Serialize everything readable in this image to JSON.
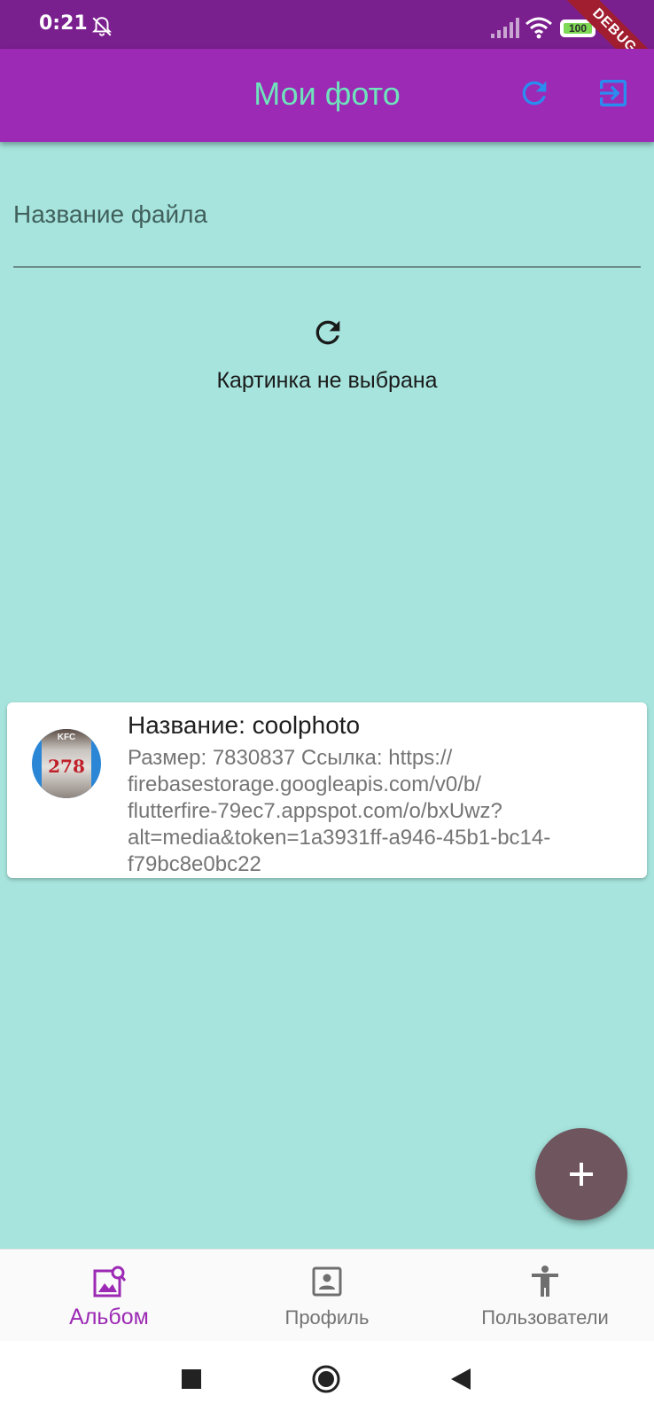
{
  "status_bar": {
    "time": "0:21",
    "battery": "100"
  },
  "debug_banner": "DEBUG",
  "app_bar": {
    "title": "Мои фото",
    "icons": [
      "refresh-icon",
      "logout-icon"
    ]
  },
  "form": {
    "filename_label": "Название файла"
  },
  "image_picker": {
    "status": "Картинка не выбрана"
  },
  "photo_card": {
    "title": "Название: coolphoto",
    "subtitle_lines": [
      "Размер: 7830837 Ссылка: https://",
      "firebasestorage.googleapis.com/v0/b/",
      "flutterfire-79ec7.appspot.com/o/bxUwz?",
      "alt=media&token=1a3931ff-a946-45b1-bc14-",
      "f79bc8e0bc22"
    ],
    "thumbnail_text_top": "KFC",
    "thumbnail_number": "278"
  },
  "fab": {
    "icon": "plus-icon"
  },
  "bottom_nav": {
    "items": [
      {
        "label": "Альбом",
        "icon": "photo-search-icon",
        "active": true
      },
      {
        "label": "Профиль",
        "icon": "profile-icon",
        "active": false
      },
      {
        "label": "Пользователи",
        "icon": "person-icon",
        "active": false
      }
    ]
  },
  "colors": {
    "app_bar": "#9c2ab4",
    "status_bar": "#7a1f8e",
    "background": "#a6e4dd",
    "title": "#6fe3bc",
    "appbar_icons": "#2b8cf0",
    "fab": "#6f555e",
    "active_nav": "#9c2ab4"
  }
}
